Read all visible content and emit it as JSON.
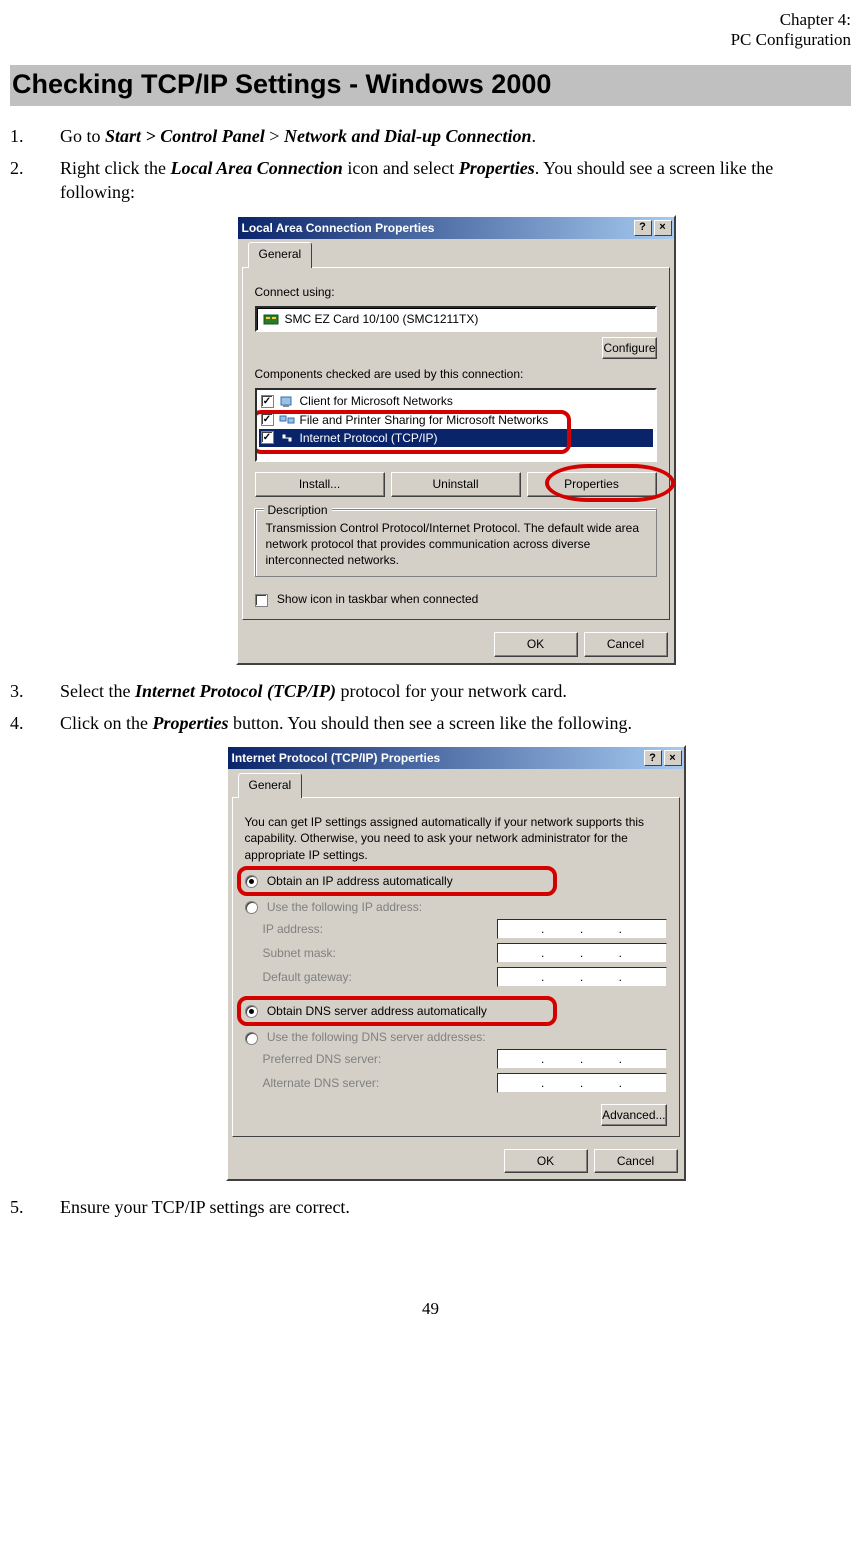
{
  "meta": {
    "chapter": "Chapter 4:",
    "section": "PC Configuration"
  },
  "h1": "Checking TCP/IP Settings - Windows 2000",
  "steps": {
    "s1": {
      "num": "1.",
      "a": "Go to ",
      "b": "Start > Control Panel",
      "c": " > ",
      "d": "Network and Dial-up Connection",
      "e": "."
    },
    "s2": {
      "num": "2.",
      "a": "Right click the ",
      "b": "Local Area Connection",
      "c": " icon and select ",
      "d": "Properties",
      "e": ". You should see a screen like the following:"
    },
    "s3": {
      "num": "3.",
      "a": "Select the ",
      "b": "Internet Protocol (TCP/IP)",
      "c": " protocol for your network card."
    },
    "s4": {
      "num": "4.",
      "a": "Click on the ",
      "b": "Properties",
      "c": " button. You should then see a screen like the following."
    },
    "s5": {
      "num": "5.",
      "a": "Ensure your TCP/IP settings are correct."
    }
  },
  "dlg1": {
    "title": "Local Area Connection Properties",
    "help": "?",
    "close": "×",
    "tab_general": "General",
    "connect_using": "Connect using:",
    "nic": "SMC EZ Card 10/100 (SMC1211TX)",
    "configure": "Configure",
    "components_label": "Components checked are used by this connection:",
    "items": {
      "client": "Client for Microsoft Networks",
      "fileshare": "File and Printer Sharing for Microsoft Networks",
      "tcpip": "Internet Protocol (TCP/IP)"
    },
    "install": "Install...",
    "uninstall": "Uninstall",
    "properties": "Properties",
    "desc_legend": "Description",
    "desc_text": "Transmission Control Protocol/Internet Protocol. The default wide area network protocol that provides communication across diverse interconnected networks.",
    "show_icon": "Show icon in taskbar when connected",
    "ok": "OK",
    "cancel": "Cancel"
  },
  "dlg2": {
    "title": "Internet Protocol (TCP/IP) Properties",
    "help": "?",
    "close": "×",
    "tab_general": "General",
    "intro": "You can get IP settings assigned automatically if your network supports this capability. Otherwise, you need to ask your network administrator for the appropriate IP settings.",
    "opt_auto_ip": "Obtain an IP address automatically",
    "opt_use_ip": "Use the following IP address:",
    "ip_address": "IP address:",
    "subnet": "Subnet mask:",
    "gateway": "Default gateway:",
    "opt_auto_dns": "Obtain DNS server address automatically",
    "opt_use_dns": "Use the following DNS server addresses:",
    "pref_dns": "Preferred DNS server:",
    "alt_dns": "Alternate DNS server:",
    "advanced": "Advanced...",
    "ok": "OK",
    "cancel": "Cancel"
  },
  "page_number": "49"
}
